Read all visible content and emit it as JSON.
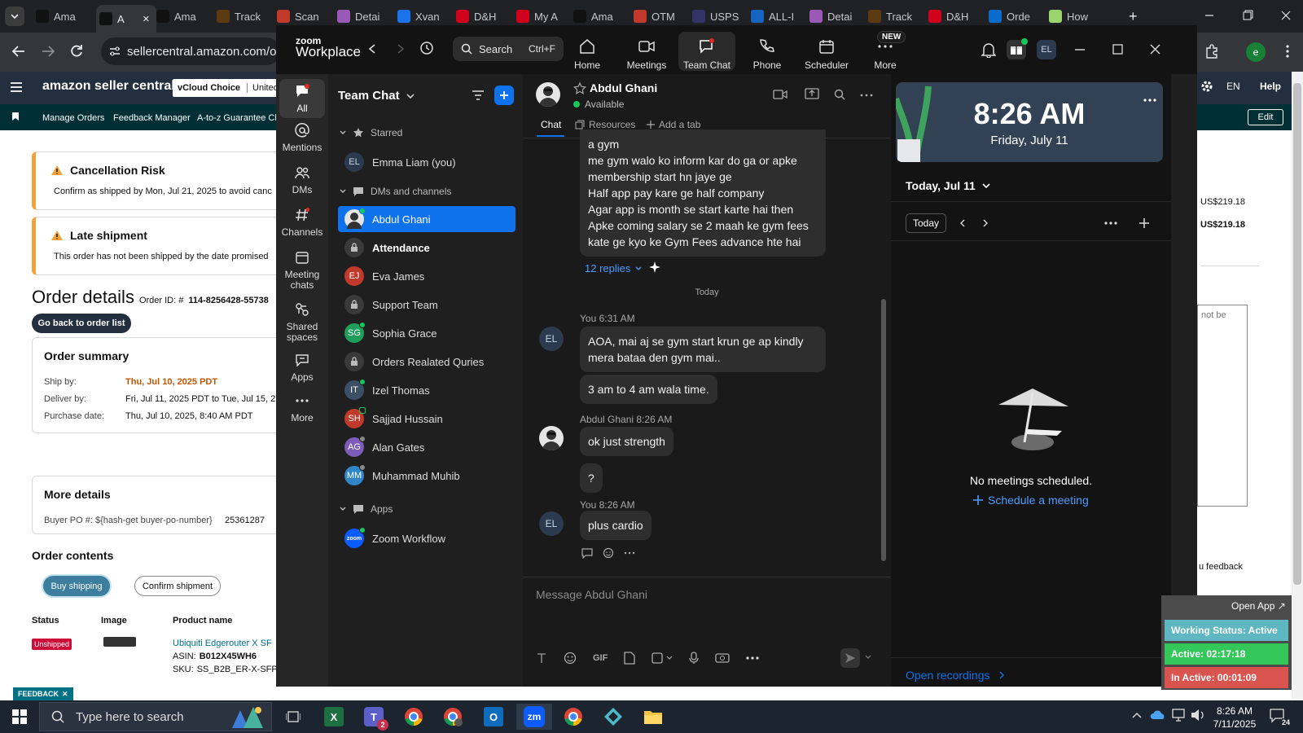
{
  "browser": {
    "tabs": [
      {
        "label": "Ama",
        "icon": "amazon-icon",
        "color": "#111111"
      },
      {
        "label": "A",
        "icon": "amazon-icon",
        "color": "#111111",
        "active": true
      },
      {
        "label": "Ama",
        "icon": "amazon-icon",
        "color": "#111111"
      },
      {
        "label": "Track",
        "icon": "ups-icon",
        "color": "#5c3a14"
      },
      {
        "label": "Scan",
        "icon": "scan-icon",
        "color": "#c0392b"
      },
      {
        "label": "Detai",
        "icon": "details-icon",
        "color": "#9b59b6"
      },
      {
        "label": "Xvan",
        "icon": "xvan-icon",
        "color": "#1a73e8"
      },
      {
        "label": "D&H",
        "icon": "dh-icon",
        "color": "#d0021b"
      },
      {
        "label": "My A",
        "icon": "my-a-icon",
        "color": "#d0021b"
      },
      {
        "label": "Ama",
        "icon": "amazon-icon",
        "color": "#111111"
      },
      {
        "label": "OTM",
        "icon": "otm-icon",
        "color": "#c0392b"
      },
      {
        "label": "USPS",
        "icon": "usps-icon",
        "color": "#333366"
      },
      {
        "label": "ALL-I",
        "icon": "seventeen-track-icon",
        "color": "#1565c0"
      },
      {
        "label": "Detai",
        "icon": "details-icon",
        "color": "#9b59b6"
      },
      {
        "label": "Track",
        "icon": "ups-icon",
        "color": "#5c3a14"
      },
      {
        "label": "D&H",
        "icon": "dh-icon",
        "color": "#d0021b"
      },
      {
        "label": "Orde",
        "icon": "ec-icon",
        "color": "#0b6bcb"
      },
      {
        "label": "How",
        "icon": "chatgpt-icon",
        "color": "#9bd46c"
      }
    ],
    "url": "sellercentral.amazon.com/ord",
    "profile_initial": "e"
  },
  "seller": {
    "logo": "amazon seller central",
    "store": "vCloud Choice",
    "market": "United S",
    "lang": "EN",
    "help": "Help",
    "edit": "Edit",
    "nav": [
      "Manage Orders",
      "Feedback Manager",
      "A-to-z Guarantee Cla"
    ],
    "cancellation_title": "Cancellation Risk",
    "cancellation_text": "Confirm as shipped by Mon, Jul 21, 2025 to avoid canc",
    "late_title": "Late shipment",
    "late_text": "This order has not been shipped by the date promised",
    "order_title": "Order details",
    "order_id_label": "Order ID: #",
    "order_id": "114-8256428-55738",
    "back_button": "Go back to order list",
    "summary_title": "Order summary",
    "ship_by_label": "Ship by:",
    "ship_by": "Thu, Jul 10, 2025 PDT",
    "deliver_by_label": "Deliver by:",
    "deliver_by": "Fri, Jul 11, 2025 PDT to Tue, Jul 15, 2",
    "purchase_label": "Purchase date:",
    "purchase": "Thu, Jul 10, 2025, 8:40 AM PDT",
    "price1": "US$219.18",
    "price2": "US$219.18",
    "note_text": "not be",
    "feedback_text": "u feedback",
    "more_title": "More details",
    "buyer_po_label": "Buyer PO #: ${hash-get buyer-po-number}",
    "buyer_po": "25361287",
    "contents_title": "Order contents",
    "buy_shipping": "Buy shipping",
    "confirm_shipment": "Confirm shipment",
    "col_status": "Status",
    "col_image": "Image",
    "col_product": "Product name",
    "status_badge": "Unshipped",
    "product_name": "Ubiquiti Edgerouter X SF",
    "asin_label": "ASIN:",
    "asin": "B012X45WH6",
    "sku_label": "SKU:",
    "sku": "SS_B2B_ER-X-SFP-U",
    "feedback_tab": "FEEDBACK"
  },
  "zoom": {
    "logo_top": "zoom",
    "logo_bottom": "Workplace",
    "search": "Search",
    "shortcut": "Ctrl+F",
    "nav": [
      {
        "label": "Home",
        "icon": "home-icon"
      },
      {
        "label": "Meetings",
        "icon": "video-icon"
      },
      {
        "label": "Team Chat",
        "icon": "chat-icon",
        "active": true
      },
      {
        "label": "Phone",
        "icon": "phone-icon"
      },
      {
        "label": "Scheduler",
        "icon": "scheduler-icon"
      },
      {
        "label": "More",
        "icon": "more-icon"
      }
    ],
    "new_badge": "NEW",
    "user_initials": "EL",
    "rail": [
      {
        "label": "All",
        "icon": "chat-bubble-icon"
      },
      {
        "label": "Mentions",
        "icon": "at-icon"
      },
      {
        "label": "DMs",
        "icon": "people-icon"
      },
      {
        "label": "Channels",
        "icon": "hash-icon"
      },
      {
        "label": "Meeting chats",
        "icon": "calendar-icon"
      },
      {
        "label": "Shared spaces",
        "icon": "shared-icon"
      },
      {
        "label": "Apps",
        "icon": "apps-icon"
      },
      {
        "label": "More",
        "icon": "ellipsis-icon"
      }
    ],
    "list_title": "Team Chat",
    "starred": "Starred",
    "starred_item": {
      "initials": "EL",
      "name": "Emma Liam (you)",
      "color": "#2b3a4e"
    },
    "dms_header": "DMs and channels",
    "dms": [
      {
        "initials": "",
        "name": "Abdul Ghani",
        "kind": "photo",
        "color": "#e6e6e6",
        "selected": true
      },
      {
        "initials": "",
        "name": "Attendance",
        "kind": "lock",
        "color": "#3a3a3a",
        "bold": true
      },
      {
        "initials": "EJ",
        "name": "Eva James",
        "kind": "avatar",
        "color": "#c0392b"
      },
      {
        "initials": "",
        "name": "Support Team",
        "kind": "lock",
        "color": "#3a3a3a"
      },
      {
        "initials": "SG",
        "name": "Sophia Grace",
        "kind": "avatar",
        "color": "#1e9e5a"
      },
      {
        "initials": "",
        "name": "Orders Realated Quries",
        "kind": "lock",
        "color": "#3a3a3a"
      },
      {
        "initials": "IT",
        "name": "Izel Thomas",
        "kind": "avatar",
        "color": "#3b4f66"
      },
      {
        "initials": "SH",
        "name": "Sajjad Hussain",
        "kind": "avatar",
        "color": "#c0392b"
      },
      {
        "initials": "AG",
        "name": "Alan Gates",
        "kind": "avatar",
        "color": "#7b5cb8"
      },
      {
        "initials": "MM",
        "name": "Muhammad Muhib",
        "kind": "avatar",
        "color": "#2f86c9"
      }
    ],
    "apps_header": "Apps",
    "apps_item": {
      "initials": "zoom",
      "name": "Zoom Workflow",
      "color": "#0b5cff"
    },
    "chat_name": "Abdul Ghani",
    "chat_status": "Available",
    "tab_chat": "Chat",
    "tab_resources": "Resources",
    "tab_add": "Add a tab",
    "old_message": "a gym\nme gym walo ko inform kar do ga or apke\nmembership start hn jaye ge\nHalf app pay kare ge half company\nAgar app is month se start karte hai then\nApke coming salary se 2 maah ke gym fees\nkate ge kyo ke Gym Fees advance hte hai",
    "replies": "12 replies",
    "today_divider": "Today",
    "msg1_meta": "You 6:31 AM",
    "msg1_initials": "EL",
    "msg1_text": "AOA, mai aj se gym start krun ge ap kindly\nmera bataa den gym mai..",
    "msg1b_text": "3 am to 4 am wala time.",
    "msg2_meta": "Abdul Ghani 8:26 AM",
    "msg2_text": "ok just strength",
    "msg2b_text": "?",
    "msg3_meta": "You 8:26 AM",
    "msg3_initials": "EL",
    "msg3_text": "plus cardio",
    "composer_placeholder": "Message Abdul Ghani",
    "gif_label": "GIF",
    "clock_time": "8:26 AM",
    "clock_date": "Friday, July 11",
    "cal_heading": "Today, Jul 11",
    "today_button": "Today",
    "no_meetings": "No meetings scheduled.",
    "schedule_link": "Schedule a meeting",
    "open_recordings": "Open recordings",
    "blue": "#0e72ed"
  },
  "widget": {
    "open_app": "Open App ↗",
    "working_status": "Working Status: Active",
    "active": "Active: 02:17:18",
    "inactive": "In Active: 00:01:09"
  },
  "taskbar": {
    "search": "Type here to search",
    "time": "8:26 AM",
    "date": "7/11/2025",
    "notif_count": "24",
    "teams_badge": "2",
    "excel_letter": "X",
    "outlook_letter": "O",
    "zoom_letter": "zm"
  }
}
